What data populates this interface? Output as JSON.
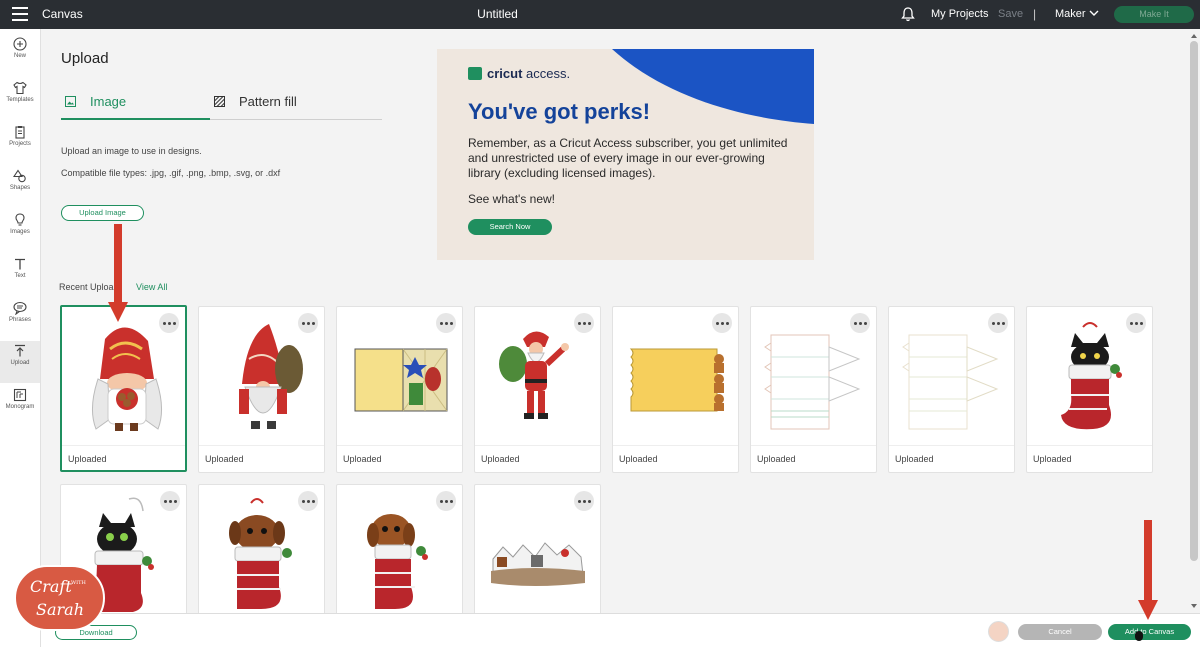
{
  "topbar": {
    "app_title": "Canvas",
    "doc_title": "Untitled",
    "my_projects": "My Projects",
    "save": "Save",
    "separator": "|",
    "machine": "Maker",
    "make_it": "Make It"
  },
  "sidebar": {
    "items": [
      {
        "label": "New",
        "icon": "plus-circle-icon"
      },
      {
        "label": "Templates",
        "icon": "shirt-icon"
      },
      {
        "label": "Projects",
        "icon": "clipboard-icon"
      },
      {
        "label": "Shapes",
        "icon": "shapes-icon"
      },
      {
        "label": "Images",
        "icon": "lightbulb-icon"
      },
      {
        "label": "Text",
        "icon": "text-icon"
      },
      {
        "label": "Phrases",
        "icon": "speech-bubble-icon"
      },
      {
        "label": "Upload",
        "icon": "upload-icon"
      },
      {
        "label": "Monogram",
        "icon": "monogram-icon"
      }
    ],
    "active": "Upload"
  },
  "upload": {
    "title": "Upload",
    "tabs": [
      {
        "label": "Image",
        "icon": "image-icon",
        "active": true
      },
      {
        "label": "Pattern fill",
        "icon": "pattern-icon",
        "active": false
      }
    ],
    "description": "Upload an image to use in designs.",
    "file_types": "Compatible file types: .jpg, .gif, .png, .bmp, .svg, or .dxf",
    "upload_button": "Upload Image"
  },
  "banner": {
    "brand_bold": "cricut",
    "brand_light": "access.",
    "headline": "You've got perks!",
    "body": "Remember, as a Cricut Access subscriber, you get unlimited and unrestricted use of every image in our ever-growing library (excluding licensed images).",
    "whats_new": "See what's new!",
    "cta": "Search Now",
    "colors": {
      "bg": "#efe7df",
      "swoosh": "#1b54c4",
      "headline": "#14439a",
      "cta": "#1f8f5f"
    }
  },
  "recent": {
    "label": "Recent Uploa",
    "view_all": "View All",
    "items": [
      {
        "label": "Uploaded",
        "thumb": "gnome-girl-cookies",
        "selected": true
      },
      {
        "label": "Uploaded",
        "thumb": "gnome-red-hat"
      },
      {
        "label": "Uploaded",
        "thumb": "card-stained-glass"
      },
      {
        "label": "Uploaded",
        "thumb": "santa-claus"
      },
      {
        "label": "Uploaded",
        "thumb": "gingerbread-card"
      },
      {
        "label": "Uploaded",
        "thumb": "box-template-outline"
      },
      {
        "label": "Uploaded",
        "thumb": "box-template-light"
      },
      {
        "label": "Uploaded",
        "thumb": "cat-stocking"
      },
      {
        "label": "",
        "thumb": "black-cat-stocking"
      },
      {
        "label": "",
        "thumb": "dog-stocking"
      },
      {
        "label": "",
        "thumb": "puppy-stocking"
      },
      {
        "label": "",
        "thumb": "winter-village"
      }
    ]
  },
  "bottom": {
    "download": "Download",
    "cancel": "Cancel",
    "add_to_canvas": "Add to Canvas"
  },
  "logo": {
    "line1": "Craft",
    "line2": "WITH",
    "line3": "Sarah"
  }
}
